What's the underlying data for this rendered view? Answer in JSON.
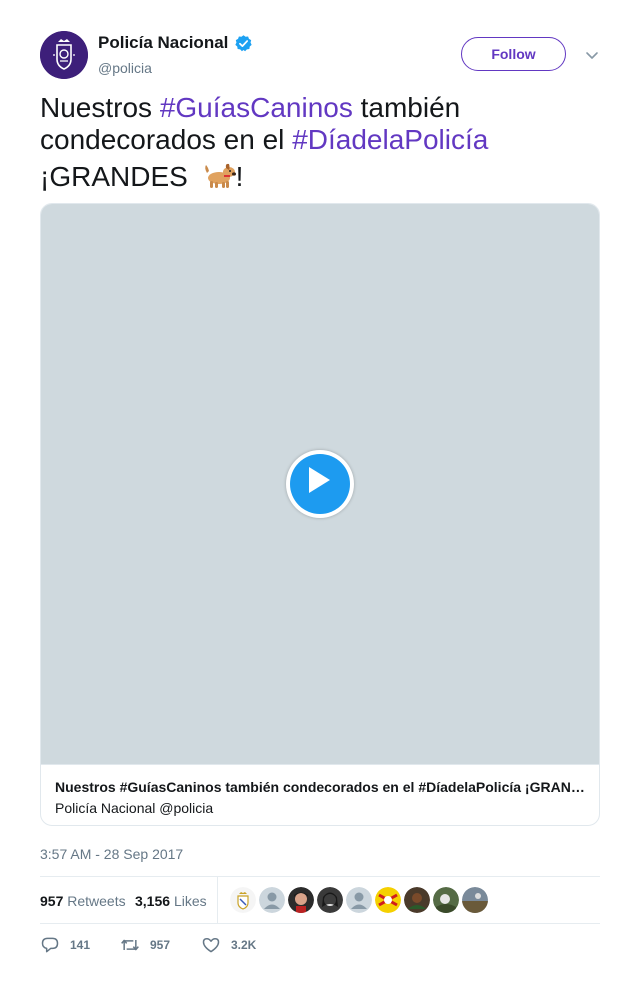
{
  "author": {
    "display_name": "Policía Nacional",
    "handle": "@policia",
    "verified": true,
    "follow_label": "Follow"
  },
  "tweet": {
    "text_part1": "Nuestros ",
    "hashtag1": "#GuíasCaninos",
    "text_part2": " también condecorados en el ",
    "hashtag2": "#DíadelaPolicía",
    "text_part3": "¡GRANDES ",
    "emoji": "dog",
    "text_part4": "!"
  },
  "media_card": {
    "title": "Nuestros #GuíasCaninos también condecorados en el #DíadelaPolicía ¡GRANDES 🐕!",
    "subtitle": "Policía Nacional @policia"
  },
  "timestamp": "3:57 AM - 28 Sep 2017",
  "stats": {
    "retweets_count": "957",
    "retweets_label": "Retweets",
    "likes_count": "3,156",
    "likes_label": "Likes"
  },
  "actions": {
    "replies": "141",
    "retweets": "957",
    "likes": "3.2K"
  },
  "colors": {
    "accent": "#6238c2",
    "play": "#1d9bf0",
    "video_bg": "#cfd9de",
    "muted_text": "#657786"
  }
}
